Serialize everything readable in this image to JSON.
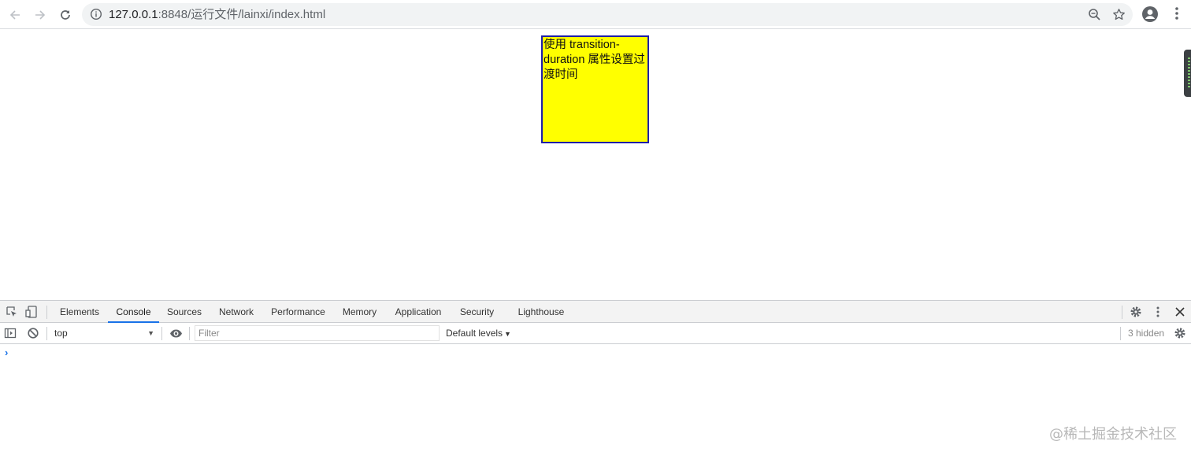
{
  "browser": {
    "url_host": "127.0.0.1",
    "url_rest": ":8848/运行文件/lainxi/index.html",
    "back_icon": "arrow-left-icon",
    "forward_icon": "arrow-right-icon",
    "reload_icon": "reload-icon"
  },
  "page": {
    "box_text": "使用 transition-duration 属性设置过渡时间",
    "box_background": "#ffff00",
    "box_border": "#1f1fa8"
  },
  "devtools": {
    "tabs": [
      {
        "label": "Elements"
      },
      {
        "label": "Console"
      },
      {
        "label": "Sources"
      },
      {
        "label": "Network"
      },
      {
        "label": "Performance"
      },
      {
        "label": "Memory"
      },
      {
        "label": "Application"
      },
      {
        "label": "Security"
      },
      {
        "label": "Lighthouse"
      }
    ],
    "active_tab": "Console",
    "console": {
      "context": "top",
      "filter_placeholder": "Filter",
      "levels": "Default levels",
      "hidden": "3 hidden",
      "prompt": "›"
    },
    "accent": "#1a73e8"
  },
  "watermark": "@稀土掘金技术社区"
}
